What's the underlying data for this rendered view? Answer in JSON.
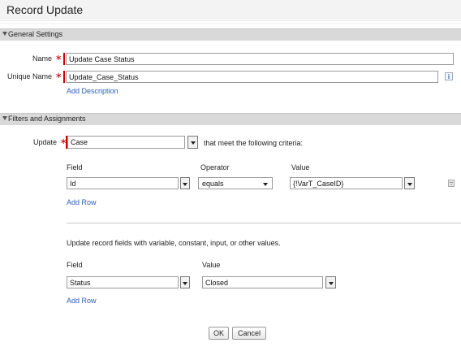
{
  "window": {
    "title": "Record Update"
  },
  "general_settings": {
    "header": "General Settings",
    "name_label": "Name",
    "name_value": "Update Case Status",
    "unique_name_label": "Unique Name",
    "unique_name_value": "Update_Case_Status",
    "info_glyph": "i",
    "add_description": "Add Description"
  },
  "filters": {
    "header": "Filters and Assignments",
    "update_label": "Update",
    "update_object": "Case",
    "criteria_text": "that meet the following criteria:",
    "columns": {
      "field": "Field",
      "operator": "Operator",
      "value": "Value"
    },
    "rows": [
      {
        "field": "Id",
        "operator": "equals",
        "value": "{!VarT_CaseID}"
      }
    ],
    "add_row": "Add Row"
  },
  "assignments": {
    "description": "Update record fields with variable, constant, input, or other values.",
    "columns": {
      "field": "Field",
      "value": "Value"
    },
    "rows": [
      {
        "field": "Status",
        "value": "Closed"
      }
    ],
    "add_row": "Add Row"
  },
  "footer": {
    "ok": "OK",
    "cancel": "Cancel"
  },
  "colors": {
    "required": "#cc0000",
    "link": "#2a60b5",
    "section_bg": "#d9d9d9"
  },
  "icons": [
    "triangle-down-icon",
    "info-icon",
    "dropdown-arrow-icon",
    "trash-icon"
  ]
}
